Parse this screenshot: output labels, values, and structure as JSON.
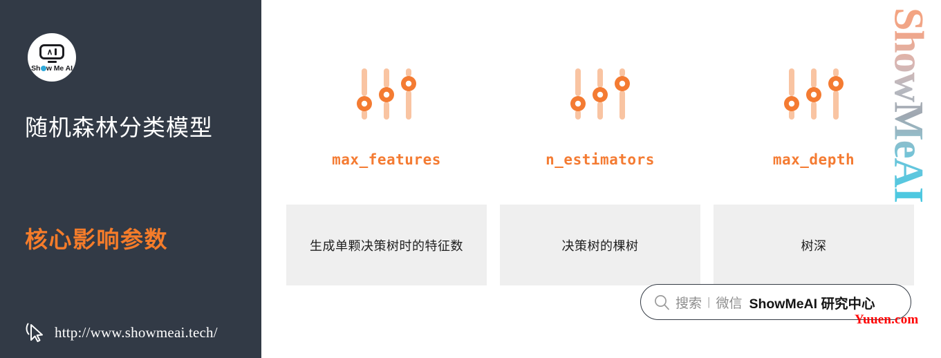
{
  "sidebar": {
    "logo": {
      "icon_name": "showmeai-logo",
      "wordmark_pre": "Sh",
      "wordmark_post": "w Me AI"
    },
    "title": "随机森林分类模型",
    "subtitle": "核心影响参数",
    "cursor_icon": "cursor-pointer-icon",
    "url": "http://www.showmeai.tech/",
    "background_color": "#323a46",
    "accent_color": "#f57c2a"
  },
  "main": {
    "params": [
      {
        "icon": "slider-settings-icon",
        "label": "max_features",
        "description": "生成单颗决策树时的特征数"
      },
      {
        "icon": "slider-settings-icon",
        "label": "n_estimators",
        "description": "决策树的棵树"
      },
      {
        "icon": "slider-settings-icon",
        "label": "max_depth",
        "description": "树深"
      }
    ],
    "label_color": "#f47b32",
    "desc_box_color": "#efefef"
  },
  "search_bar": {
    "icon": "search-icon",
    "placeholder_text": "搜索",
    "divider": "|",
    "channel": "微信",
    "brand": "ShowMeAI 研究中心"
  },
  "watermarks": {
    "vertical_brand": "ShowMeAI",
    "corner_text": "Yuuen.com",
    "corner_color": "#ff0000"
  }
}
